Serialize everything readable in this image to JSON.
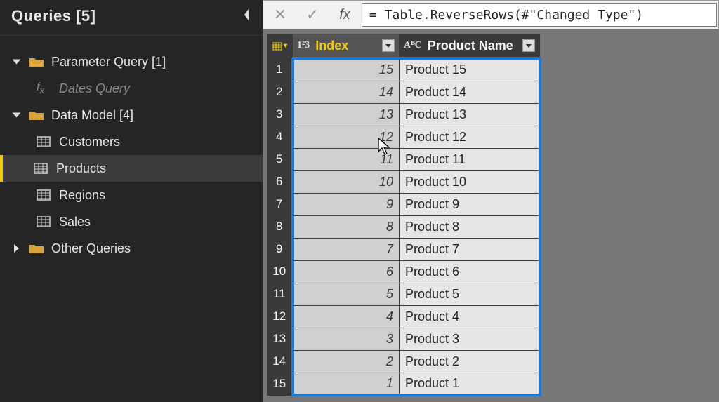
{
  "sidebar": {
    "title": "Queries [5]",
    "groups": [
      {
        "label": "Parameter Query [1]",
        "expanded": true,
        "items": [
          {
            "label": "Dates Query",
            "kind": "fx",
            "dimmed": true
          }
        ]
      },
      {
        "label": "Data Model [4]",
        "expanded": true,
        "items": [
          {
            "label": "Customers",
            "kind": "table"
          },
          {
            "label": "Products",
            "kind": "table",
            "selected": true
          },
          {
            "label": "Regions",
            "kind": "table"
          },
          {
            "label": "Sales",
            "kind": "table"
          }
        ]
      },
      {
        "label": "Other Queries",
        "expanded": false,
        "items": []
      }
    ]
  },
  "formula_bar": {
    "cancel_glyph": "✕",
    "commit_glyph": "✓",
    "fx_label": "fx",
    "value": "= Table.ReverseRows(#\"Changed Type\")"
  },
  "grid": {
    "columns": [
      {
        "name": "Index",
        "type_icon": "1²3",
        "selected": true
      },
      {
        "name": "Product Name",
        "type_icon": "AᴮC",
        "selected": false
      }
    ],
    "rows": [
      {
        "n": 1,
        "index": 15,
        "name": "Product 15"
      },
      {
        "n": 2,
        "index": 14,
        "name": "Product 14"
      },
      {
        "n": 3,
        "index": 13,
        "name": "Product 13"
      },
      {
        "n": 4,
        "index": 12,
        "name": "Product 12"
      },
      {
        "n": 5,
        "index": 11,
        "name": "Product 11"
      },
      {
        "n": 6,
        "index": 10,
        "name": "Product 10"
      },
      {
        "n": 7,
        "index": 9,
        "name": "Product 9"
      },
      {
        "n": 8,
        "index": 8,
        "name": "Product 8"
      },
      {
        "n": 9,
        "index": 7,
        "name": "Product 7"
      },
      {
        "n": 10,
        "index": 6,
        "name": "Product 6"
      },
      {
        "n": 11,
        "index": 5,
        "name": "Product 5"
      },
      {
        "n": 12,
        "index": 4,
        "name": "Product 4"
      },
      {
        "n": 13,
        "index": 3,
        "name": "Product 3"
      },
      {
        "n": 14,
        "index": 2,
        "name": "Product 2"
      },
      {
        "n": 15,
        "index": 1,
        "name": "Product 1"
      }
    ]
  }
}
